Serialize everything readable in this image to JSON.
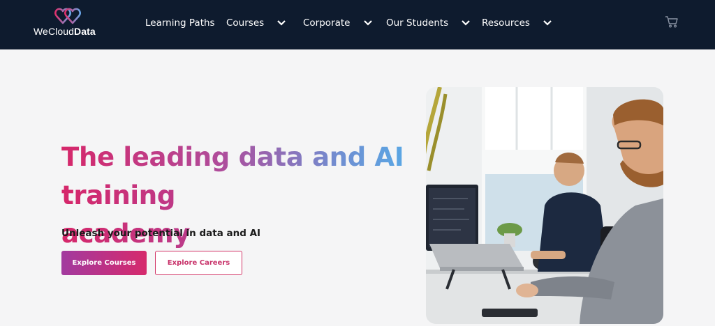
{
  "brand": {
    "name_light": "WeCloud",
    "name_bold": "Data",
    "icon": "heart-logo-icon"
  },
  "nav": {
    "items": [
      {
        "label": "Learning Paths",
        "has_dropdown": false
      },
      {
        "label": "Courses",
        "has_dropdown": true
      },
      {
        "label": "Corporate",
        "has_dropdown": true
      },
      {
        "label": "Our Students",
        "has_dropdown": true
      },
      {
        "label": "Resources",
        "has_dropdown": true
      }
    ],
    "cart_icon": "cart-icon"
  },
  "hero": {
    "headline_line1": "The leading data and AI",
    "headline_line2": "training academy",
    "subtitle": "Unleash your potential in data and AI",
    "primary_button": "Explore Courses",
    "secondary_button": "Explore Careers"
  },
  "colors": {
    "header_bg": "#0e1b2e",
    "page_bg": "#f5f5f6",
    "accent_pink": "#d6276a",
    "accent_purple": "#a23a9f",
    "accent_blue": "#58a9e6"
  }
}
